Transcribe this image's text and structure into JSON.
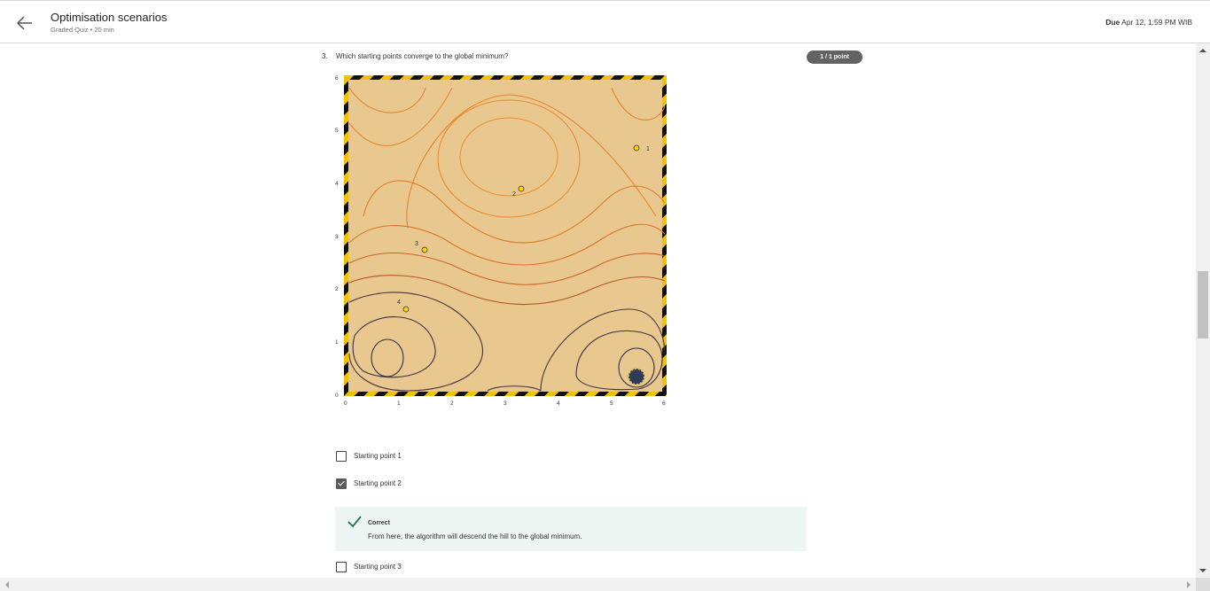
{
  "header": {
    "title": "Optimisation scenarios",
    "subtitle": "Graded Quiz • 20 min",
    "due_label": "Due",
    "due_value": "Apr 12, 1:59 PM WIB"
  },
  "question": {
    "number": "3.",
    "text": "Which starting points converge to the global minimum?",
    "points": "1 / 1 point"
  },
  "plot": {
    "x_ticks": [
      "0",
      "1",
      "2",
      "3",
      "4",
      "5",
      "6"
    ],
    "y_ticks": [
      "0",
      "1",
      "2",
      "3",
      "4",
      "5",
      "6"
    ],
    "point_labels": [
      "1",
      "2",
      "3",
      "4"
    ],
    "colors": {
      "background": "#e8c88f",
      "contour_high": "#f08c2e",
      "contour_low": "#3a2e44",
      "point": "#ffd400"
    }
  },
  "options": [
    {
      "label": "Starting point 1",
      "checked": false
    },
    {
      "label": "Starting point 2",
      "checked": true
    },
    {
      "label": "Starting point 3",
      "checked": false
    }
  ],
  "feedback": {
    "title": "Correct",
    "text": "From here, the algorithm will descend the hill to the global minimum.",
    "color": "#1e7a4c"
  }
}
